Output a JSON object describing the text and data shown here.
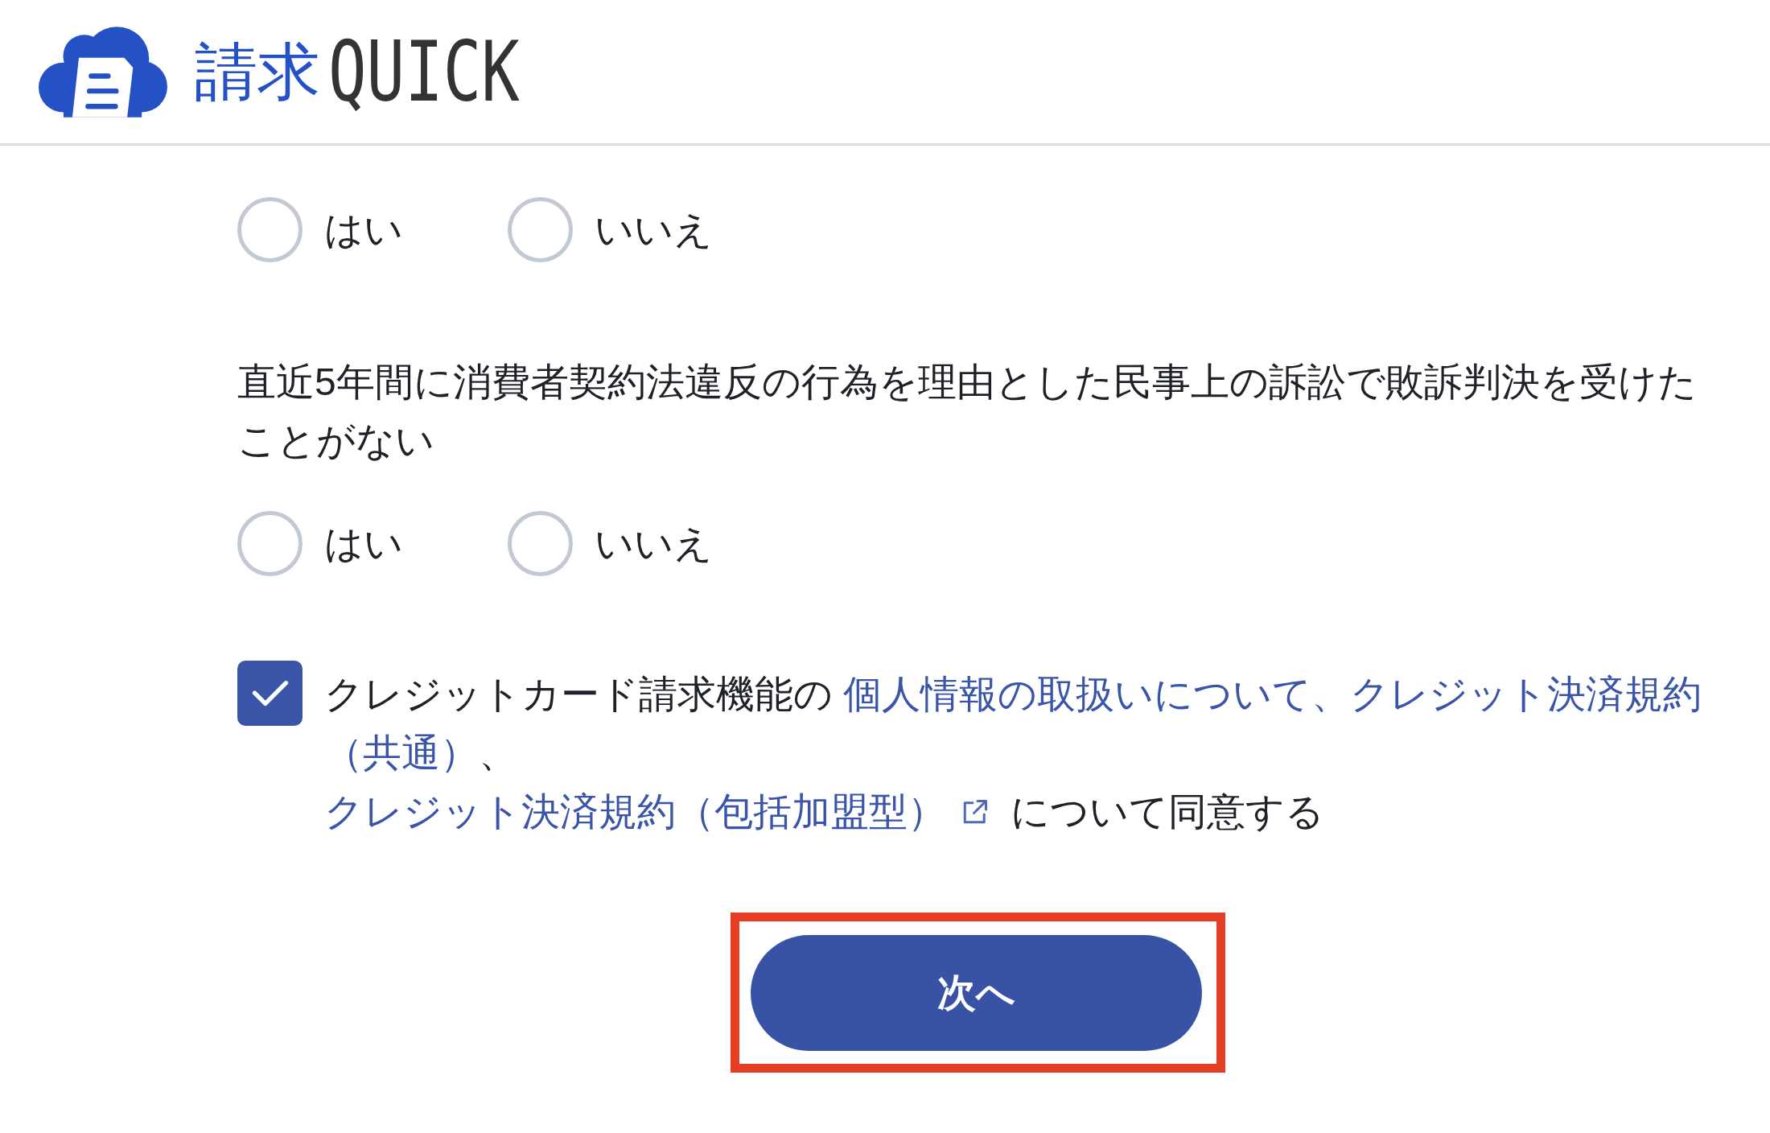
{
  "header": {
    "logo": {
      "parts": [
        "請求",
        "QUICK"
      ]
    }
  },
  "questions": [
    {
      "options": [
        {
          "label": "はい",
          "selected": false
        },
        {
          "label": "いいえ",
          "selected": false
        }
      ]
    },
    {
      "text": "直近5年間に消費者契約法違反の行為を理由とした民事上の訴訟で敗訴判決を受けたことがない",
      "options": [
        {
          "label": "はい",
          "selected": false
        },
        {
          "label": "いいえ",
          "selected": false
        }
      ]
    }
  ],
  "consent": {
    "checked": true,
    "lines": [
      [
        {
          "kind": "text",
          "text": "クレジットカード請求機能の "
        },
        {
          "kind": "link",
          "text": "個人情報の取扱いについて、クレジット決済規約"
        },
        {
          "kind": "link",
          "text": "（共通）"
        },
        {
          "kind": "text",
          "text": "、"
        }
      ],
      [
        {
          "kind": "link",
          "text": "クレジット決済規約（包括加盟型）",
          "external": true
        },
        {
          "kind": "text",
          "text": "について同意する"
        }
      ]
    ]
  },
  "next_button": {
    "label": "次へ",
    "highlighted": true
  }
}
